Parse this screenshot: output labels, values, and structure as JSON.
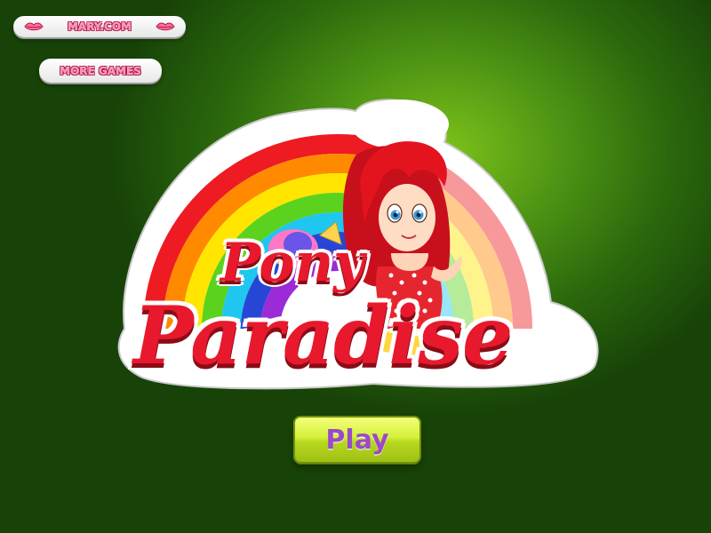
{
  "top_links": {
    "site_label": "MARY.COM",
    "more_games_label": "MORE GAMES"
  },
  "logo": {
    "line1": "Pony",
    "line2": "Paradise"
  },
  "play_button": {
    "label": "Play"
  },
  "colors": {
    "background_green": "#4e9414",
    "title_red": "#e8192d",
    "play_button": "#d4f03a",
    "play_text": "#9b49c7",
    "pill_pink": "#ff8fb3"
  }
}
